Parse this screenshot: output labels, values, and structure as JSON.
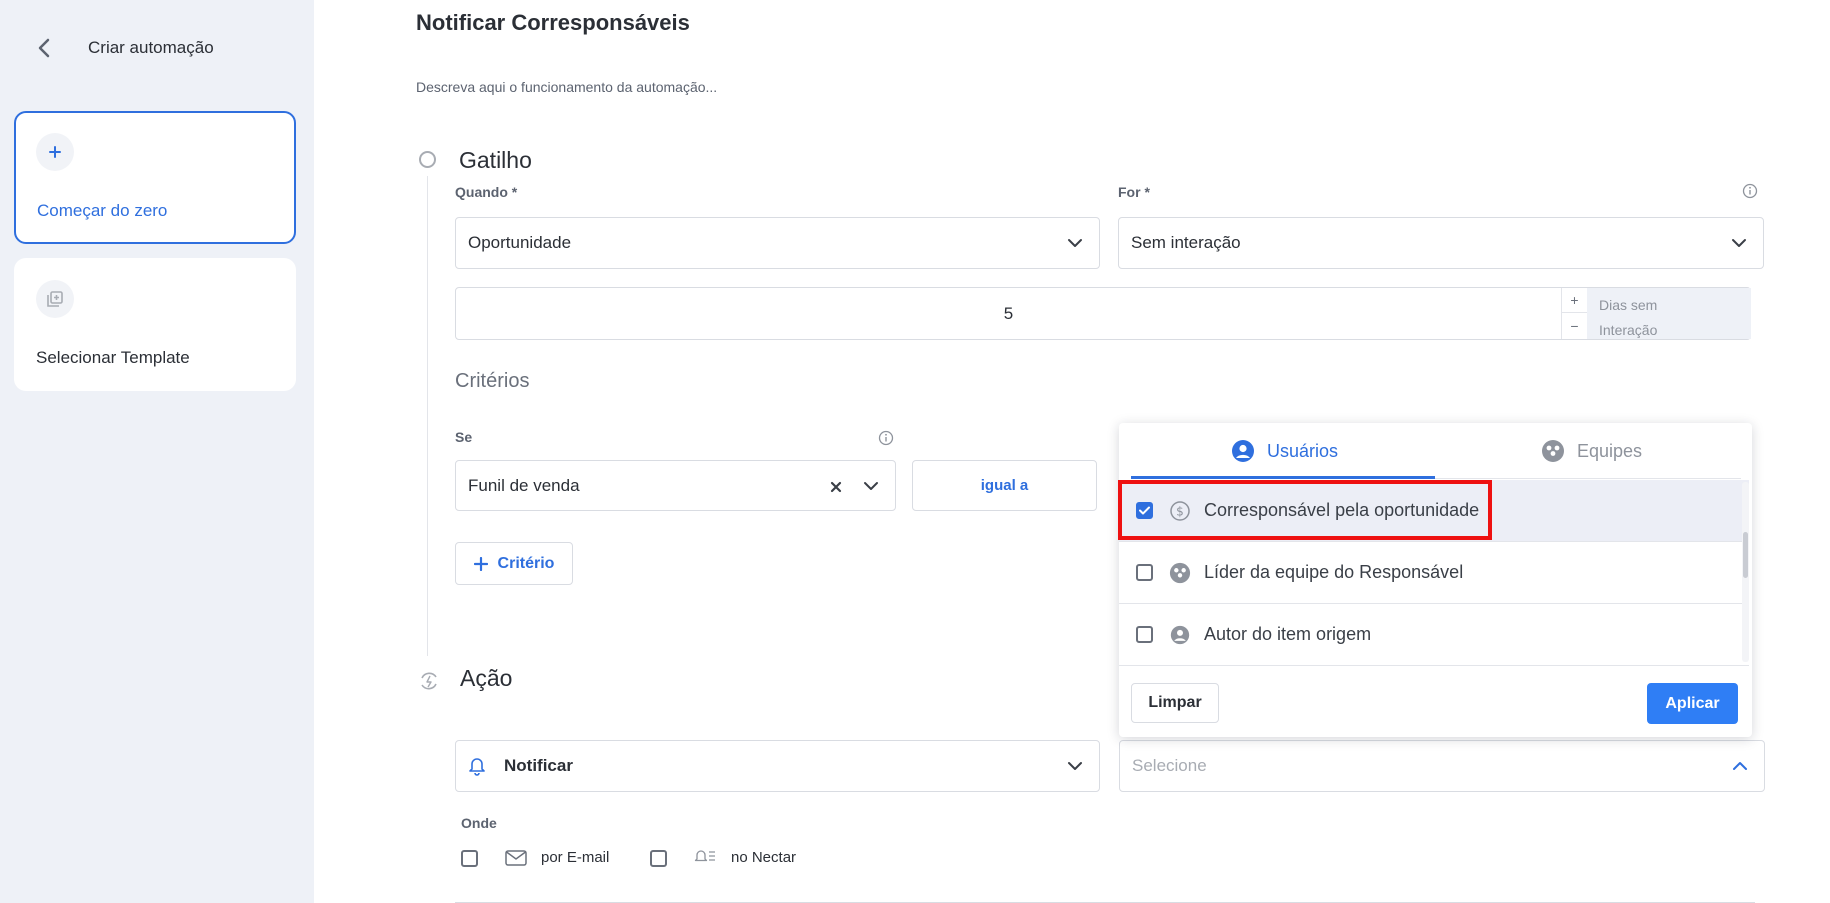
{
  "sidebar": {
    "title": "Criar automação",
    "cards": [
      {
        "label": "Começar do zero",
        "icon": "plus-icon"
      },
      {
        "label": "Selecionar Template",
        "icon": "template-icon"
      }
    ]
  },
  "main": {
    "title": "Notificar Corresponsáveis",
    "description": "Descreva aqui o funcionamento da automação...",
    "trigger": {
      "title": "Gatilho",
      "quando_label": "Quando *",
      "quando_value": "Oportunidade",
      "for_label": "For *",
      "for_value": "Sem interação",
      "number_value": "5",
      "unit_line1": "Dias sem",
      "unit_line2": "Interação",
      "stepper_plus": "+",
      "stepper_minus": "−"
    },
    "criteria": {
      "title": "Critérios",
      "se_label": "Se",
      "se_value": "Funil de venda",
      "operator": "igual a",
      "add_label": "Critério"
    },
    "action": {
      "title": "Ação",
      "type_value": "Notificar",
      "target_placeholder": "Selecione",
      "onde_label": "Onde",
      "options": [
        {
          "label": "por E-mail",
          "icon": "mail-icon",
          "checked": false
        },
        {
          "label": "no Nectar",
          "icon": "bell-list-icon",
          "checked": false
        }
      ]
    }
  },
  "dropdown": {
    "tabs": [
      {
        "label": "Usuários",
        "icon": "user-circle-icon",
        "active": true
      },
      {
        "label": "Equipes",
        "icon": "team-icon",
        "active": false
      }
    ],
    "items": [
      {
        "label": "Corresponsável pela oportunidade",
        "icon": "dollar-circle-icon",
        "checked": true
      },
      {
        "label": "Líder da equipe do Responsável",
        "icon": "team-icon",
        "checked": false
      },
      {
        "label": "Autor do item origem",
        "icon": "user-circle-icon",
        "checked": false
      }
    ],
    "clear_label": "Limpar",
    "apply_label": "Aplicar"
  },
  "colors": {
    "accent": "#2f6fde",
    "apply_button": "#2f7ef5",
    "highlight": "#ee1111",
    "sidebar_bg": "#eef1f7"
  }
}
